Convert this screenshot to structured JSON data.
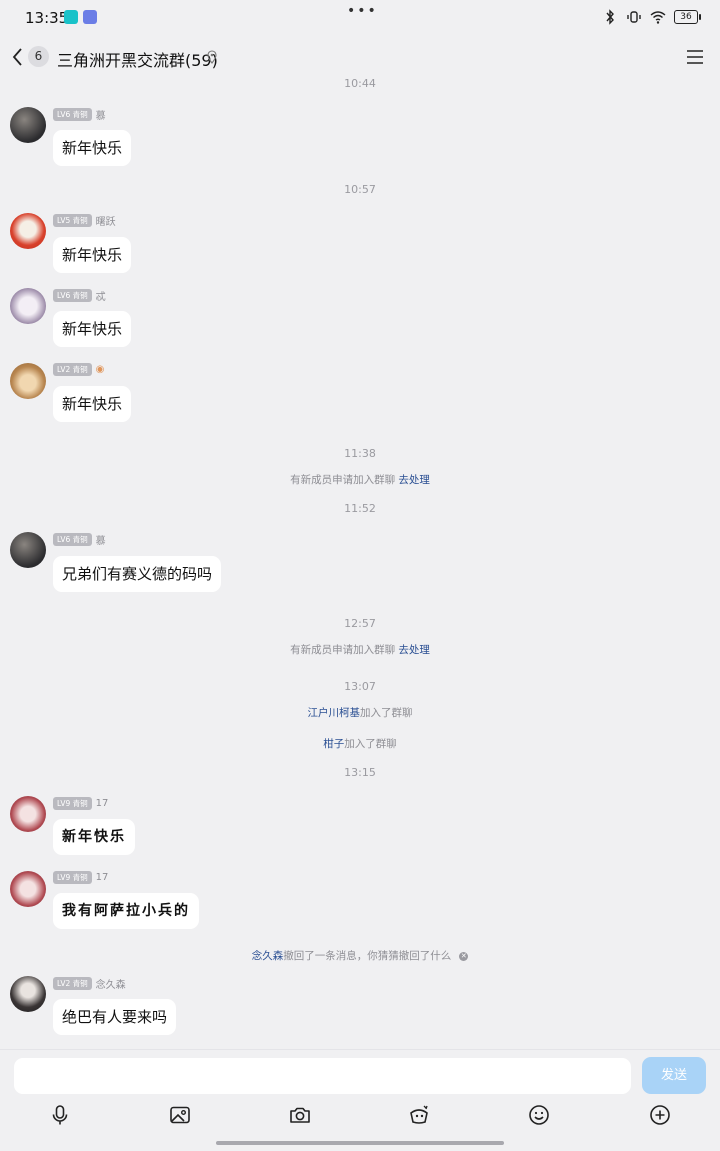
{
  "status_bar": {
    "time": "13:35",
    "battery": "36"
  },
  "header": {
    "back_count": "6",
    "title": "三角洲开黑交流群(59)"
  },
  "messages": [
    {
      "type": "time",
      "text": "10:44"
    },
    {
      "type": "msg",
      "level": "LV6 青铜",
      "nick": "慕",
      "text": "新年快乐"
    },
    {
      "type": "time",
      "text": "10:57"
    },
    {
      "type": "msg",
      "level": "LV5 青铜",
      "nick": "曙跃",
      "text": "新年快乐"
    },
    {
      "type": "msg",
      "level": "LV6 青铜",
      "nick": "忒",
      "text": "新年快乐"
    },
    {
      "type": "msg",
      "level": "LV2 青铜",
      "nick": "",
      "text": "新年快乐"
    },
    {
      "type": "time",
      "text": "11:38"
    },
    {
      "type": "sys",
      "text": "有新成员申请加入群聊 ",
      "link": "去处理"
    },
    {
      "type": "time",
      "text": "11:52"
    },
    {
      "type": "msg",
      "level": "LV6 青铜",
      "nick": "慕",
      "text": "兄弟们有赛义德的码吗"
    },
    {
      "type": "time",
      "text": "12:57"
    },
    {
      "type": "sys",
      "text": "有新成员申请加入群聊 ",
      "link": "去处理"
    },
    {
      "type": "time",
      "text": "13:07"
    },
    {
      "type": "join",
      "name": "江户川柯基",
      "text": "加入了群聊"
    },
    {
      "type": "join",
      "name": "柑子",
      "text": "加入了群聊"
    },
    {
      "type": "time",
      "text": "13:15"
    },
    {
      "type": "msg",
      "level": "LV9 青铜",
      "nick": "17",
      "text": "新年快乐"
    },
    {
      "type": "msg",
      "level": "LV9 青铜",
      "nick": "17",
      "text": "我有阿萨拉小兵的"
    },
    {
      "type": "recall",
      "name": "念久森",
      "text": "撤回了一条消息，你猜猜撤回了什么"
    },
    {
      "type": "msg",
      "level": "LV2 青铜",
      "nick": "念久森",
      "text": "绝巴有人要来吗"
    }
  ],
  "input": {
    "placeholder": "",
    "send_label": "发送"
  },
  "colors": {
    "background": "#f0f0f2",
    "link": "#2a4f93",
    "send_disabled": "#a9d3f7"
  },
  "toolbar_icons": [
    "mic-icon",
    "image-icon",
    "camera-icon",
    "redpacket-icon",
    "emoji-icon",
    "plus-icon"
  ]
}
